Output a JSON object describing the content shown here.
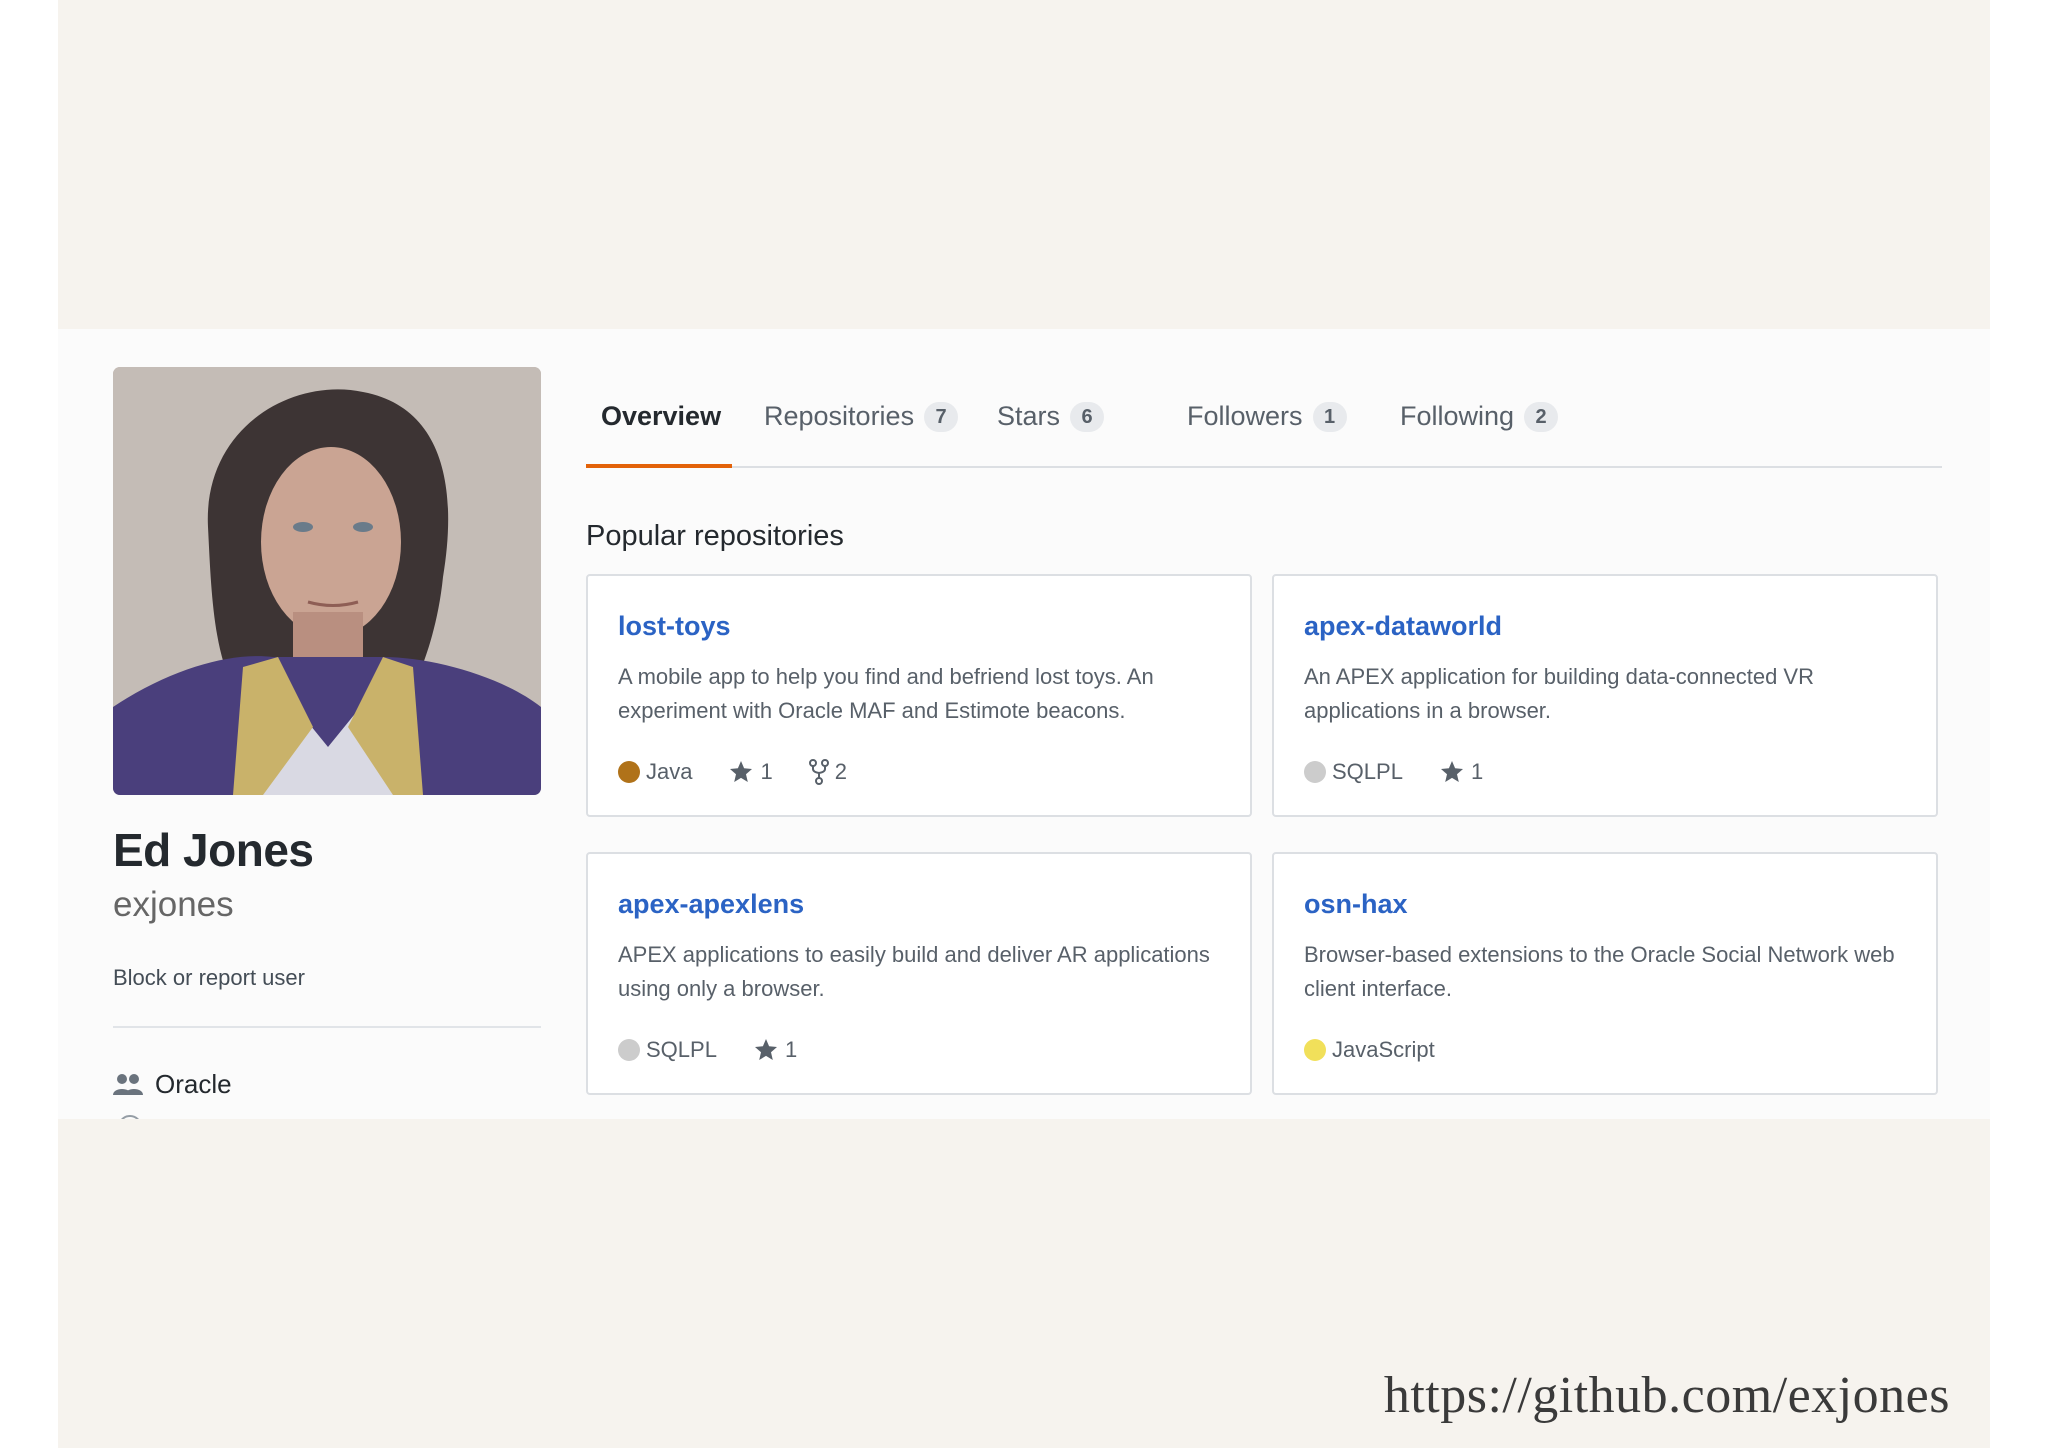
{
  "profile": {
    "full_name": "Ed Jones",
    "login": "exjones",
    "block_link": "Block or report user",
    "organization": "Oracle"
  },
  "tabs": [
    {
      "label": "Overview",
      "count": null,
      "active": true
    },
    {
      "label": "Repositories",
      "count": "7",
      "active": false
    },
    {
      "label": "Stars",
      "count": "6",
      "active": false
    },
    {
      "label": "Followers",
      "count": "1",
      "active": false
    },
    {
      "label": "Following",
      "count": "2",
      "active": false
    }
  ],
  "popular": {
    "title": "Popular repositories",
    "repos": [
      {
        "name": "lost-toys",
        "description": "A mobile app to help you find and befriend lost toys. An experiment with Oracle MAF and Estimote beacons.",
        "language": "Java",
        "language_color": "#b07219",
        "stars": "1",
        "forks": "2"
      },
      {
        "name": "apex-dataworld",
        "description": "An APEX application for building data-connected VR applications in a browser.",
        "language": "SQLPL",
        "language_color": "#cccccc",
        "stars": "1",
        "forks": null
      },
      {
        "name": "apex-apexlens",
        "description": "APEX applications to easily build and deliver AR applications using only a browser.",
        "language": "SQLPL",
        "language_color": "#cccccc",
        "stars": "1",
        "forks": null
      },
      {
        "name": "osn-hax",
        "description": "Browser-based extensions to the Oracle Social Network web client interface.",
        "language": "JavaScript",
        "language_color": "#f1e05a",
        "stars": null,
        "forks": null
      }
    ]
  },
  "footer": {
    "url": "https://github.com/exjones"
  },
  "colors": {
    "accent_underline": "#e36209",
    "link": "#2b63c4"
  },
  "icons": {
    "star": "star-icon",
    "fork": "fork-icon",
    "organization": "people-icon"
  }
}
